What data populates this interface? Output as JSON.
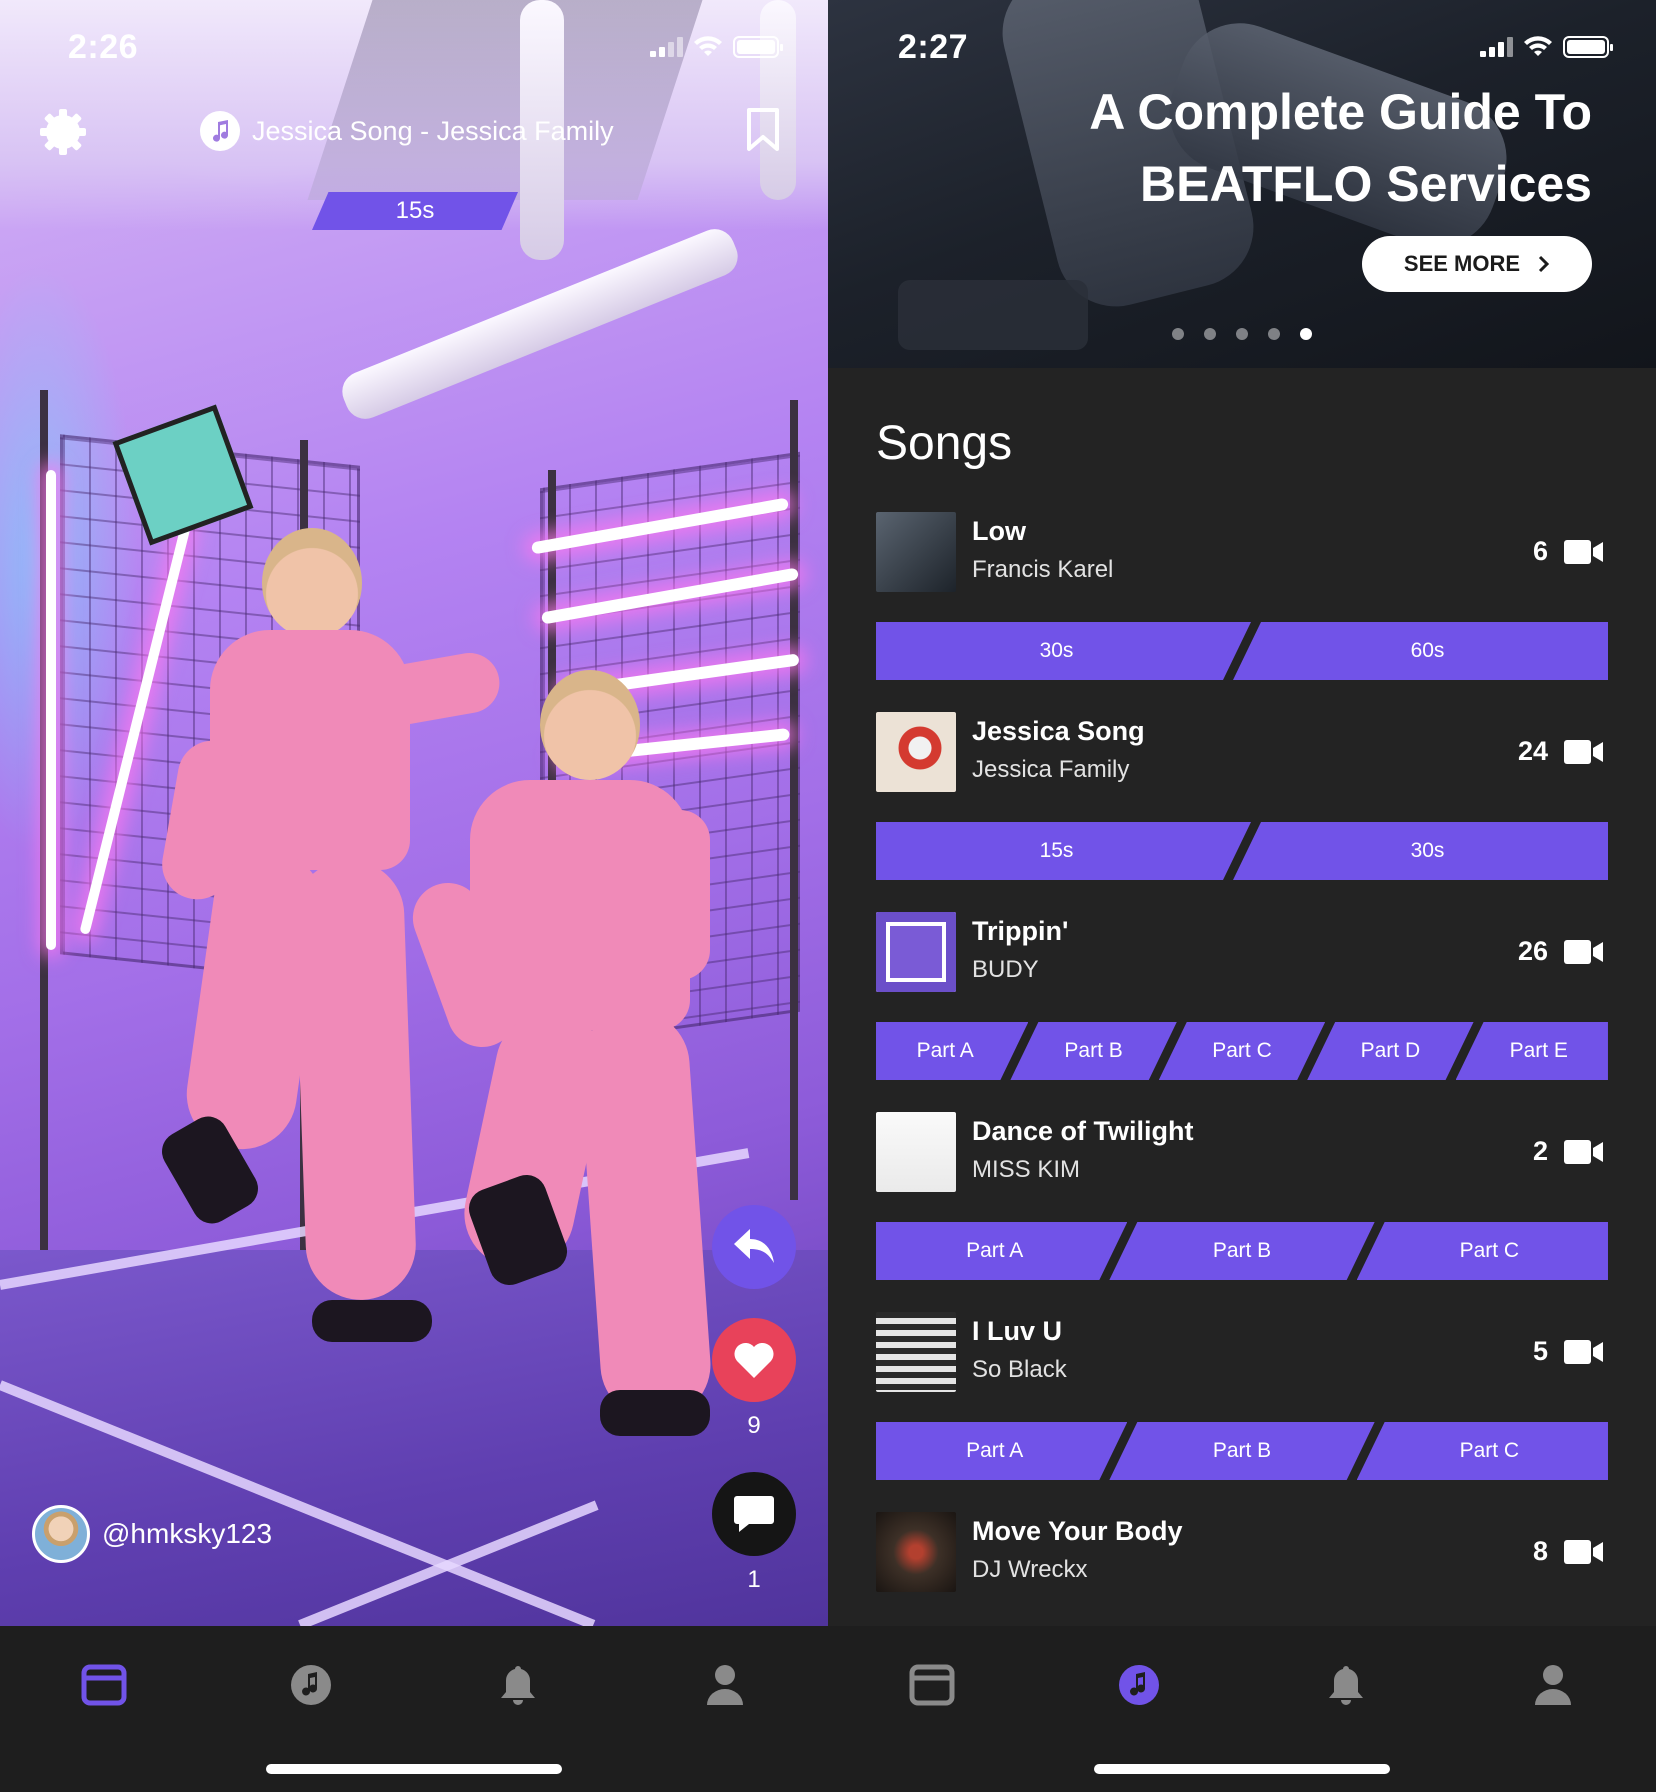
{
  "left": {
    "status_time": "2:26",
    "song_title": "Jessica Song - Jessica Family",
    "duration_tag": "15s",
    "likes_count": "9",
    "comments_count": "1",
    "username": "@hmksky123",
    "icons": [
      "gear-icon",
      "music-note-icon",
      "bookmark-icon",
      "share-icon",
      "heart-icon",
      "comment-icon"
    ]
  },
  "right": {
    "status_time": "2:27",
    "hero": {
      "title_line1": "A Complete Guide To",
      "title_line2": "BEATFLO Services",
      "cta": "SEE MORE",
      "dots_total": 5,
      "dots_active": 5
    },
    "songs_heading": "Songs",
    "songs": [
      {
        "title": "Low",
        "artist": "Francis Karel",
        "count": "6",
        "parts": [
          "30s",
          "60s"
        ]
      },
      {
        "title": "Jessica Song",
        "artist": "Jessica Family",
        "count": "24",
        "parts": [
          "15s",
          "30s"
        ]
      },
      {
        "title": "Trippin'",
        "artist": "BUDY",
        "count": "26",
        "parts": [
          "Part A",
          "Part B",
          "Part C",
          "Part D",
          "Part E"
        ]
      },
      {
        "title": "Dance of Twilight",
        "artist": "MISS KIM",
        "count": "2",
        "parts": [
          "Part A",
          "Part B",
          "Part C"
        ]
      },
      {
        "title": "I Luv U",
        "artist": "So Black",
        "count": "5",
        "parts": [
          "Part A",
          "Part B",
          "Part C"
        ]
      },
      {
        "title": "Move Your Body",
        "artist": "DJ Wreckx",
        "count": "8",
        "parts": []
      }
    ]
  },
  "tabbar": {
    "tabs": [
      "feed",
      "music",
      "notifications",
      "profile"
    ],
    "left_active": "feed",
    "right_active": "music",
    "colors": {
      "active": "#7153e8",
      "inactive": "#a8a8a8"
    }
  },
  "colors": {
    "accent": "#7153e8",
    "like": "#e8425a",
    "background": "#232323"
  }
}
